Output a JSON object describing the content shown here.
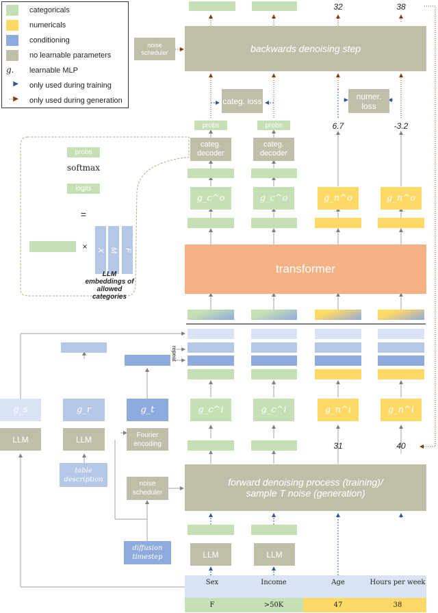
{
  "legend": {
    "items": [
      {
        "label": "categoricals",
        "swatch": "green",
        "color": "#c5e0b4"
      },
      {
        "label": "numericals",
        "swatch": "yellow",
        "color": "#ffd966"
      },
      {
        "label": "conditioning",
        "swatch": "blue",
        "color": "#8faadc"
      },
      {
        "label": "no learnable parameters",
        "swatch": "gray",
        "color": "#bfbfa9"
      },
      {
        "label": "learnable MLP",
        "symbol": "g."
      },
      {
        "label": "only used during training",
        "symbol": "blue-arrow"
      },
      {
        "label": "only used during generation",
        "symbol": "brown-dotted-arrow"
      }
    ]
  },
  "top": {
    "outputs": [
      "",
      "",
      "32",
      "38"
    ],
    "noise_scheduler": "noise scheduler",
    "backwards_step": "backwards denoising step",
    "categ_loss": "categ. loss",
    "numer_loss": "numer. loss"
  },
  "decoder": {
    "probs": [
      "probs",
      "probs"
    ],
    "categ_decoder": [
      "categ. decoder",
      "categ. decoder"
    ],
    "numeric_outputs": [
      "6.7",
      "-3.2"
    ],
    "output_mlps": [
      "g_c^o",
      "g_c^o",
      "g_n^o",
      "g_n^o"
    ]
  },
  "inset": {
    "probs": "probs",
    "softmax": "softmax",
    "logits": "logits",
    "equals": "=",
    "times": "×",
    "embedding_letters": [
      "X",
      "M",
      "F"
    ],
    "caption": "LLM embeddings of allowed categories"
  },
  "transformer": {
    "label": "transformer"
  },
  "conditioning": {
    "repeat_label": "repeat",
    "g_s": "g_s",
    "g_r": "g_r",
    "g_t": "g_t",
    "llm_s": "LLM",
    "llm_r": "LLM",
    "fourier": "Fourier encoding",
    "table_description": "table description",
    "noise_scheduler": "noise scheduler",
    "diffusion_timestep": "diffusion timestep"
  },
  "input": {
    "input_mlps": [
      "g_c^i",
      "g_c^i",
      "g_n^i",
      "g_n^i"
    ],
    "numeric_inputs": [
      "31",
      "40"
    ],
    "forward_process_line1": "forward denoising process (training)/",
    "forward_process_line2": "sample T noise (generation)",
    "llm_labels": [
      "LLM",
      "LLM"
    ]
  },
  "table": {
    "columns": [
      "Sex",
      "Income",
      "Age",
      "Hours per week"
    ],
    "row": [
      "F",
      ">50K",
      "47",
      "38"
    ]
  }
}
